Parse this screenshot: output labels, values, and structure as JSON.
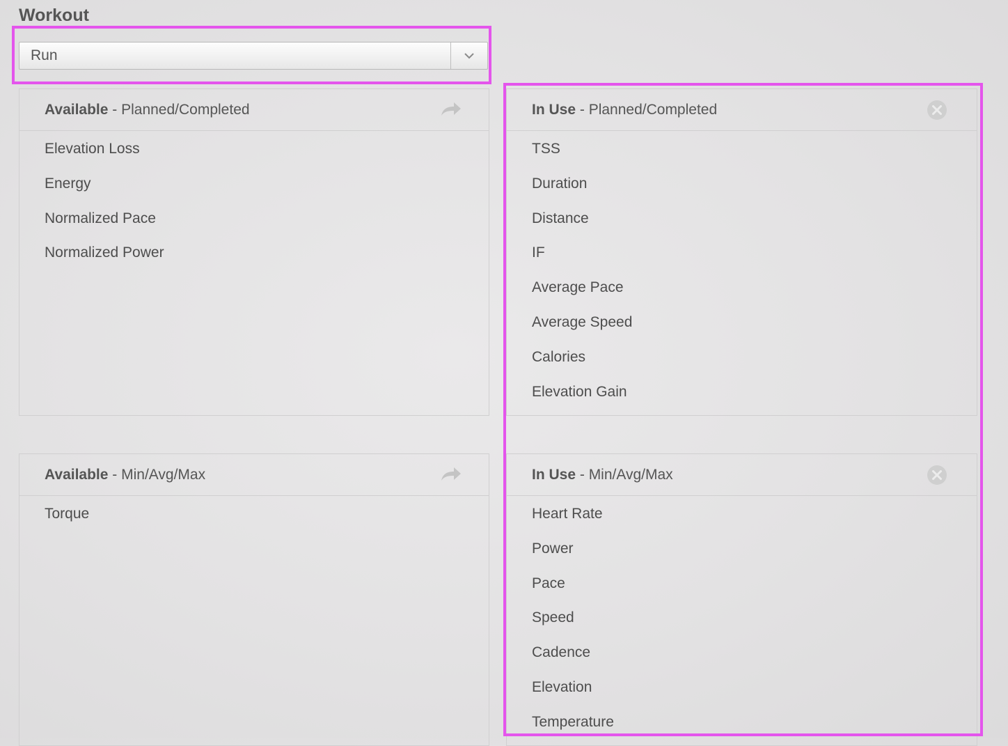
{
  "title": "Workout",
  "select": {
    "value": "Run"
  },
  "panels": {
    "available_planned": {
      "title_bold": "Available",
      "title_rest": " - Planned/Completed",
      "items": [
        "Elevation Loss",
        "Energy",
        "Normalized Pace",
        "Normalized Power"
      ]
    },
    "inuse_planned": {
      "title_bold": "In Use",
      "title_rest": " - Planned/Completed",
      "items": [
        "TSS",
        "Duration",
        "Distance",
        "IF",
        "Average Pace",
        "Average Speed",
        "Calories",
        "Elevation Gain"
      ]
    },
    "available_minavgmax": {
      "title_bold": "Available",
      "title_rest": " - Min/Avg/Max",
      "items": [
        "Torque"
      ]
    },
    "inuse_minavgmax": {
      "title_bold": "In Use",
      "title_rest": " - Min/Avg/Max",
      "items": [
        "Heart Rate",
        "Power",
        "Pace",
        "Speed",
        "Cadence",
        "Elevation",
        "Temperature"
      ]
    }
  },
  "colors": {
    "highlight": "#e455ec",
    "text": "#4d4d4d",
    "icon": "#c4c4c4"
  }
}
